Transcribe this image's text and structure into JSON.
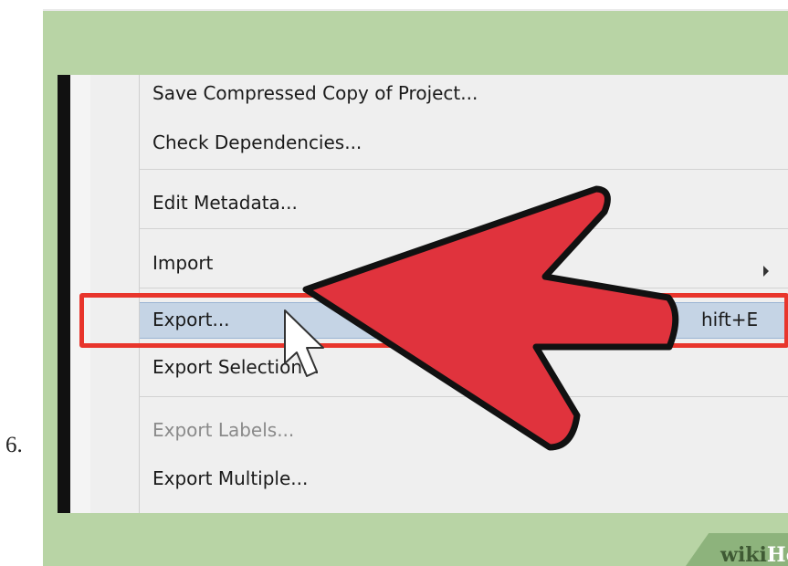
{
  "step_number": "6.",
  "menu": {
    "items": [
      {
        "label": "Save Compressed Copy of Project...",
        "state": "normal"
      },
      {
        "label": "Check Dependencies...",
        "state": "normal"
      },
      {
        "label": "Edit Metadata...",
        "state": "normal"
      },
      {
        "label": "Import",
        "state": "normal",
        "has_submenu": true
      },
      {
        "label": "Export...",
        "state": "highlighted",
        "shortcut_visible": "hift+E"
      },
      {
        "label": "Export Selection...",
        "state": "normal"
      },
      {
        "label": "Export Labels...",
        "state": "disabled"
      },
      {
        "label": "Export Multiple...",
        "state": "normal"
      }
    ]
  },
  "icons": {
    "arrow": "red-pointer-arrow-icon",
    "cursor": "mouse-cursor-icon",
    "submenu": "chevron-right-icon"
  },
  "colors": {
    "frame_background": "#b8d4a5",
    "menu_background": "#efefef",
    "highlight": "#c5d4e5",
    "red_outline": "#e8352c",
    "arrow_fill": "#e0333d"
  },
  "watermark": {
    "wiki": "wiki",
    "how": "How"
  }
}
